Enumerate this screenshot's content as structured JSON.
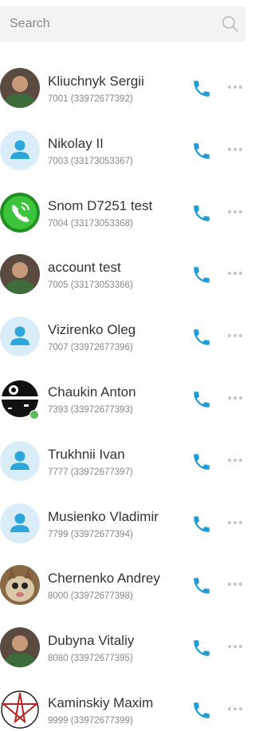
{
  "search": {
    "placeholder": "Search"
  },
  "colors": {
    "accent": "#1f9bd6",
    "online": "#5cb85c",
    "default_avatar_bg": "#d9edf8",
    "default_avatar_fg": "#2da6dc"
  },
  "contacts": [
    {
      "name": "Kliuchnyk Sergii",
      "number": "7001 (33972677392)",
      "avatar": "photo",
      "online": false
    },
    {
      "name": "Nikolay II",
      "number": "7003 (33173053367)",
      "avatar": "default-user-icon",
      "online": false
    },
    {
      "name": "Snom D7251 test",
      "number": "7004 (33173053368)",
      "avatar": "green-phone-icon",
      "online": false
    },
    {
      "name": "account test",
      "number": "7005 (33173053366)",
      "avatar": "photo",
      "online": false
    },
    {
      "name": "Vizirenko Oleg",
      "number": "7007 (33972677396)",
      "avatar": "default-user-icon",
      "online": false
    },
    {
      "name": "Chaukin Anton",
      "number": "7393 (33972677393)",
      "avatar": "death-star-icon",
      "online": true
    },
    {
      "name": "Trukhnii Ivan",
      "number": "7777 (33972677397)",
      "avatar": "default-user-icon",
      "online": false
    },
    {
      "name": "Musienko Vladimir",
      "number": "7799 (33972677394)",
      "avatar": "default-user-icon",
      "online": false
    },
    {
      "name": "Chernenko Andrey",
      "number": "8000 (33972677398)",
      "avatar": "cat-photo",
      "online": false
    },
    {
      "name": "Dubyna Vitaliy",
      "number": "8080 (33972677395)",
      "avatar": "photo",
      "online": false
    },
    {
      "name": "Kaminskiy Maxim",
      "number": "9999 (33972677399)",
      "avatar": "star-emblem-icon",
      "online": false
    }
  ]
}
